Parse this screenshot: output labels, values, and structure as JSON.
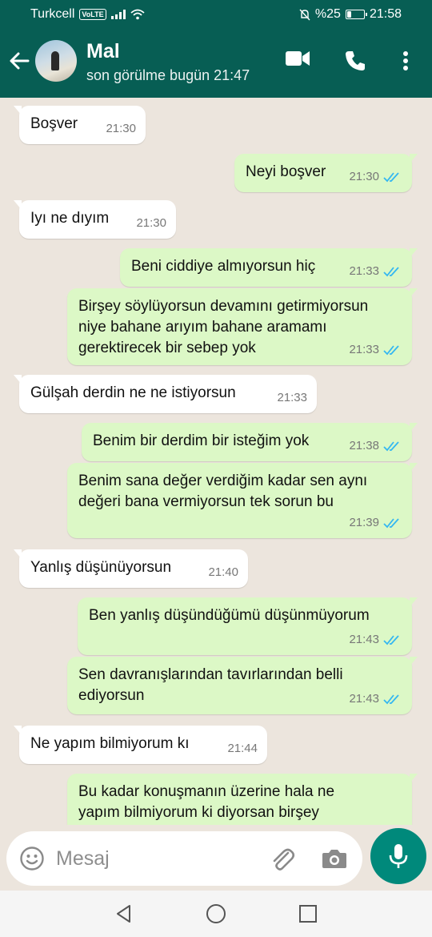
{
  "status_bar": {
    "carrier": "Turkcell",
    "volte": "VoLTE",
    "battery_text": "%25",
    "battery_level": 0.25,
    "time": "21:58"
  },
  "header": {
    "name": "Mal",
    "status": "son görülme bugün 21:47",
    "icons": [
      "back-arrow-icon",
      "avatar",
      "video-call-icon",
      "phone-icon",
      "more-vert-icon"
    ]
  },
  "messages": [
    {
      "dir": "in",
      "text": "Boşver",
      "time": "21:30"
    },
    {
      "dir": "out",
      "text": "Neyi boşver",
      "time": "21:30",
      "read": true
    },
    {
      "dir": "in",
      "text": "Iyı ne dıyım",
      "time": "21:30"
    },
    {
      "dir": "out",
      "text": "Beni ciddiye almıyorsun hiç",
      "time": "21:33",
      "read": true
    },
    {
      "dir": "out",
      "text": "Birşey söylüyorsun devamını getirmiyorsun\nniye bahane arıyım bahane aramamı\ngerektirecek bir sebep yok",
      "time": "21:33",
      "read": true
    },
    {
      "dir": "in",
      "text": "Gülşah derdin ne ne istiyorsun",
      "time": "21:33"
    },
    {
      "dir": "out",
      "text": "Benim bir derdim bir isteğim yok",
      "time": "21:38",
      "read": true
    },
    {
      "dir": "out",
      "text": "Benim sana değer verdiğim kadar sen aynı\ndeğeri bana vermiyorsun tek sorun bu",
      "time": "21:39",
      "read": true
    },
    {
      "dir": "in",
      "text": "Yanlış düşünüyorsun",
      "time": "21:40"
    },
    {
      "dir": "out",
      "text": "Ben yanlış düşündüğümü düşünmüyorum",
      "time": "21:43",
      "read": true
    },
    {
      "dir": "out",
      "text": "Sen davranışlarından tavırlarından belli\nediyorsun",
      "time": "21:43",
      "read": true
    },
    {
      "dir": "in",
      "text": "Ne yapım bilmiyorum kı",
      "time": "21:44"
    },
    {
      "dir": "out",
      "text": "Bu kadar konuşmanın üzerine hala ne\nyapım bilmiyorum ki diyorsan birşey",
      "time": "",
      "read": false
    }
  ],
  "input": {
    "placeholder": "Mesaj",
    "value": ""
  },
  "colors": {
    "header": "#075e54",
    "outgoing_bubble": "#dcf8c6",
    "incoming_bubble": "#ffffff",
    "read_ticks": "#34b7f1",
    "mic_button": "#00897b"
  }
}
